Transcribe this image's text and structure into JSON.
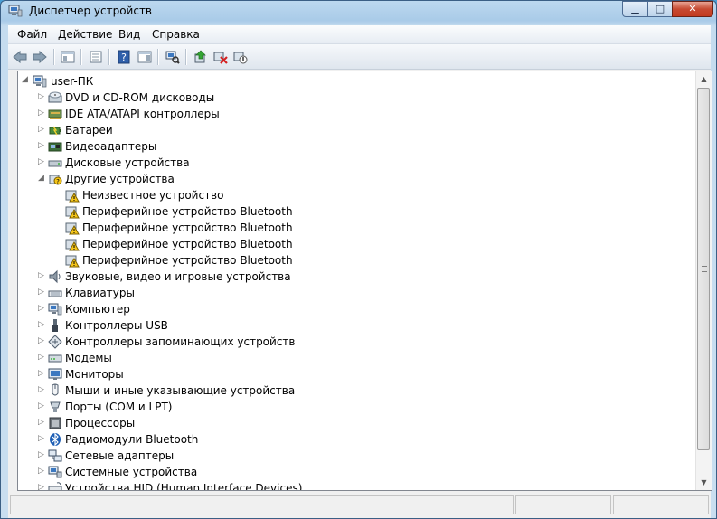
{
  "window": {
    "title": "Диспетчер устройств"
  },
  "menu": [
    {
      "label": "Файл"
    },
    {
      "label": "Действие"
    },
    {
      "label": "Вид"
    },
    {
      "label": "Справка"
    }
  ],
  "toolbar": {
    "buttons": [
      "back-icon",
      "forward-icon",
      "show-hide-tree-icon",
      "properties-icon",
      "help-icon",
      "action-pane-icon",
      "scan-hardware-icon",
      "update-driver-icon",
      "uninstall-icon",
      "disable-icon"
    ]
  },
  "tree": {
    "root": "user-ПК",
    "items": [
      {
        "label": "DVD и CD-ROM дисководы",
        "icon": "dvd-drive-icon",
        "level": 1,
        "expander": "collapsed"
      },
      {
        "label": "IDE ATA/ATAPI контроллеры",
        "icon": "ide-controller-icon",
        "level": 1,
        "expander": "collapsed"
      },
      {
        "label": "Батареи",
        "icon": "battery-icon",
        "level": 1,
        "expander": "collapsed"
      },
      {
        "label": "Видеоадаптеры",
        "icon": "display-adapter-icon",
        "level": 1,
        "expander": "collapsed"
      },
      {
        "label": "Дисковые устройства",
        "icon": "disk-drive-icon",
        "level": 1,
        "expander": "collapsed"
      },
      {
        "label": "Другие устройства",
        "icon": "other-devices-icon",
        "level": 1,
        "expander": "expanded"
      },
      {
        "label": "Неизвестное устройство",
        "icon": "warning-device-icon",
        "level": 2,
        "expander": "none"
      },
      {
        "label": "Периферийное устройство Bluetooth",
        "icon": "warning-device-icon",
        "level": 2,
        "expander": "none"
      },
      {
        "label": "Периферийное устройство Bluetooth",
        "icon": "warning-device-icon",
        "level": 2,
        "expander": "none"
      },
      {
        "label": "Периферийное устройство Bluetooth",
        "icon": "warning-device-icon",
        "level": 2,
        "expander": "none"
      },
      {
        "label": "Периферийное устройство Bluetooth",
        "icon": "warning-device-icon",
        "level": 2,
        "expander": "none"
      },
      {
        "label": "Звуковые, видео и игровые устройства",
        "icon": "speaker-icon",
        "level": 1,
        "expander": "collapsed"
      },
      {
        "label": "Клавиатуры",
        "icon": "keyboard-icon",
        "level": 1,
        "expander": "collapsed"
      },
      {
        "label": "Компьютер",
        "icon": "computer-icon",
        "level": 1,
        "expander": "collapsed"
      },
      {
        "label": "Контроллеры USB",
        "icon": "usb-icon",
        "level": 1,
        "expander": "collapsed"
      },
      {
        "label": "Контроллеры запоминающих устройств",
        "icon": "storage-controller-icon",
        "level": 1,
        "expander": "collapsed"
      },
      {
        "label": "Модемы",
        "icon": "modem-icon",
        "level": 1,
        "expander": "collapsed"
      },
      {
        "label": "Мониторы",
        "icon": "monitor-icon",
        "level": 1,
        "expander": "collapsed"
      },
      {
        "label": "Мыши и иные указывающие устройства",
        "icon": "mouse-icon",
        "level": 1,
        "expander": "collapsed"
      },
      {
        "label": "Порты (COM и LPT)",
        "icon": "port-icon",
        "level": 1,
        "expander": "collapsed"
      },
      {
        "label": "Процессоры",
        "icon": "processor-icon",
        "level": 1,
        "expander": "collapsed"
      },
      {
        "label": "Радиомодули Bluetooth",
        "icon": "bluetooth-icon",
        "level": 1,
        "expander": "collapsed"
      },
      {
        "label": "Сетевые адаптеры",
        "icon": "network-adapter-icon",
        "level": 1,
        "expander": "collapsed"
      },
      {
        "label": "Системные устройства",
        "icon": "system-devices-icon",
        "level": 1,
        "expander": "collapsed"
      },
      {
        "label": "Устройства HID (Human Interface Devices)",
        "icon": "hid-icon",
        "level": 1,
        "expander": "collapsed"
      }
    ]
  },
  "colors": {
    "warning": "#f5c518",
    "titlebar": "#a9cbe8",
    "close": "#c74a32"
  }
}
